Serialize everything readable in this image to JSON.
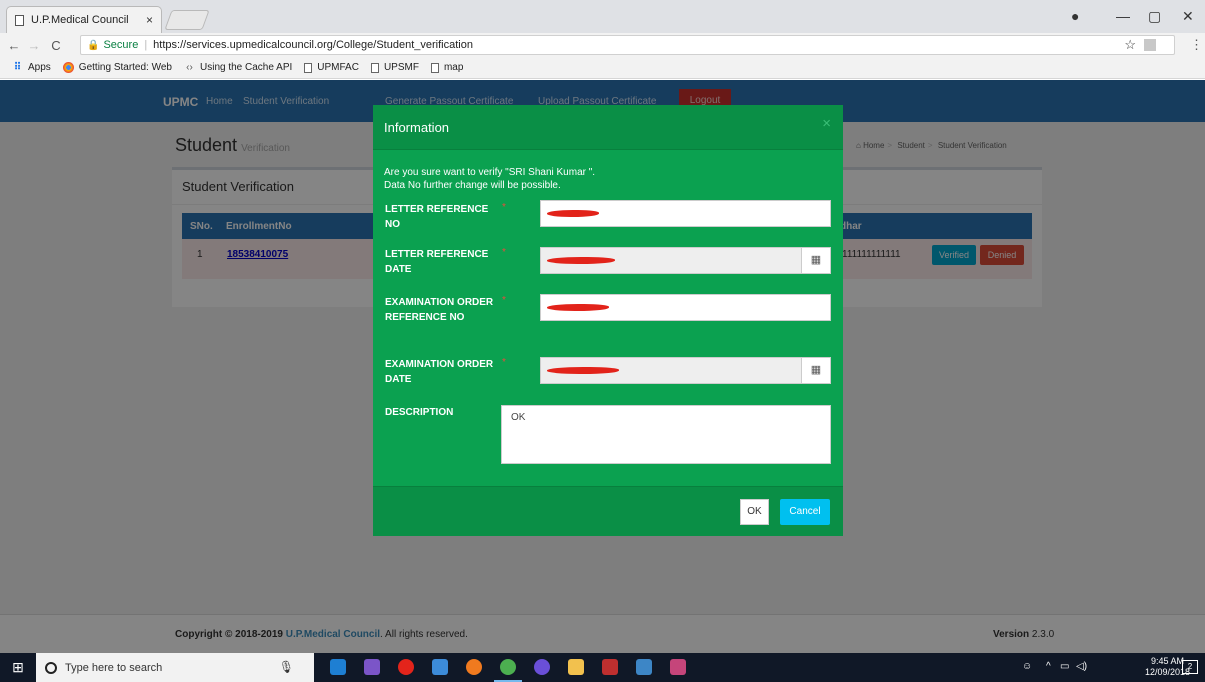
{
  "browser": {
    "tab_title": "U.P.Medical Council",
    "tab_close": "×",
    "back": "←",
    "forward": "→",
    "reload": "C",
    "secure_label": "Secure",
    "url": "https://services.upmedicalcouncil.org/College/Student_verification",
    "bookmarks": [
      {
        "label": "Apps",
        "icon": "apps-grid-icon"
      },
      {
        "label": "Getting Started: Web",
        "icon": "chrome-icon"
      },
      {
        "label": "Using the Cache API",
        "icon": "code-icon"
      },
      {
        "label": "UPMFAC",
        "icon": "page-icon"
      },
      {
        "label": "UPSMF",
        "icon": "page-icon"
      },
      {
        "label": "map",
        "icon": "page-icon"
      }
    ]
  },
  "navbar": {
    "brand": "UPMC",
    "links": [
      "Home",
      "Student Verification",
      "Generate Passout Certificate",
      "Upload Passout Certificate"
    ],
    "logout": "Logout",
    "color": "#2b74b3"
  },
  "page": {
    "title": "Student",
    "subtitle": "Verification",
    "breadcrumb": [
      "Home",
      "Student",
      "Student Verification"
    ]
  },
  "panel": {
    "title": "Student Verification",
    "columns": [
      "SNo.",
      "EnrollmentNo",
      "dhar"
    ],
    "rows": [
      {
        "sno": "1",
        "enrollment": "18538410075",
        "aadhar": "111111111111",
        "verified": "Verified",
        "denied": "Denied"
      }
    ]
  },
  "modal": {
    "title": "Information",
    "close": "×",
    "message_line1": "Are you sure want to verify \"SRI Shani Kumar \".",
    "message_line2": "Data No further change will be possible.",
    "fields": [
      {
        "label": "LETTER REFERENCE NO",
        "required": "*",
        "type": "text"
      },
      {
        "label": "LETTER REFERENCE DATE",
        "required": "*",
        "type": "date"
      },
      {
        "label": "EXAMINATION ORDER REFERENCE NO",
        "required": "*",
        "type": "text"
      },
      {
        "label": "EXAMINATION ORDER DATE",
        "required": "*",
        "type": "date"
      }
    ],
    "description_label": "DESCRIPTION",
    "description_value": "OK",
    "ok_label": "OK",
    "cancel_label": "Cancel",
    "color": "#0ba150"
  },
  "footer": {
    "copyright_prefix": "Copyright © 2018-2019",
    "council": "U.P.Medical Council",
    "rights": ". All rights reserved.",
    "version_label": "Version",
    "version": "2.3.0"
  },
  "taskbar": {
    "search_placeholder": "Type here to search",
    "time": "9:45 AM",
    "date": "12/09/2018",
    "notifications": "2"
  }
}
